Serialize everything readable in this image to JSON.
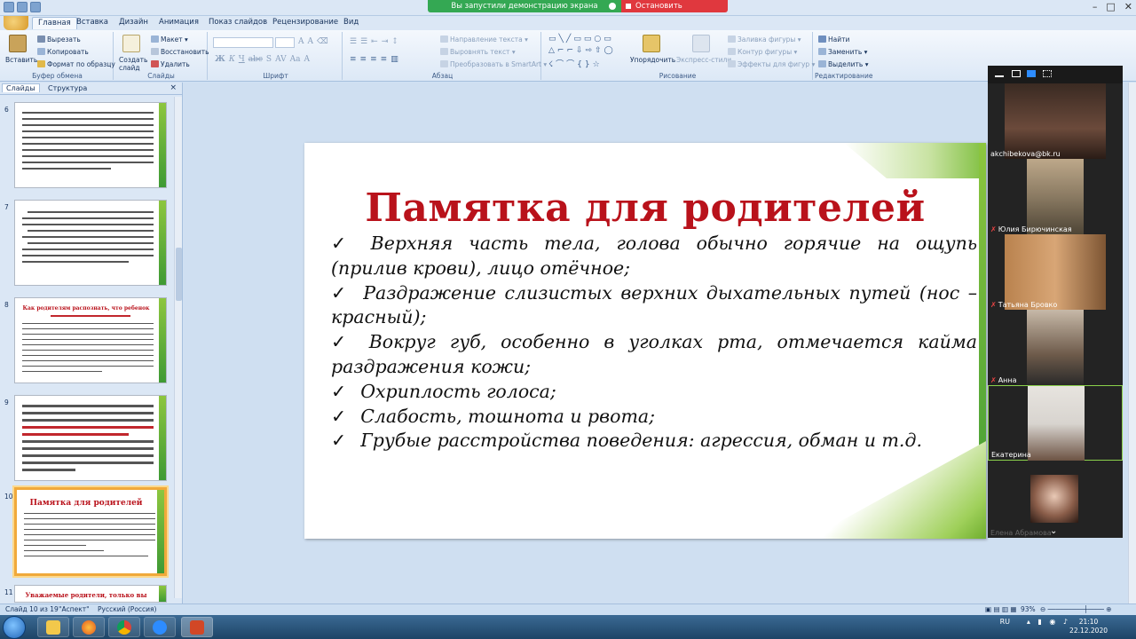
{
  "share_banner": {
    "message": "Вы запустили демонстрацию экрана",
    "stop_label": "Остановить демонстрацию"
  },
  "ribbon_tabs": [
    {
      "label": "Главная",
      "active": true
    },
    {
      "label": "Вставка"
    },
    {
      "label": "Дизайн"
    },
    {
      "label": "Анимация"
    },
    {
      "label": "Показ слайдов"
    },
    {
      "label": "Рецензирование"
    },
    {
      "label": "Вид"
    }
  ],
  "ribbon": {
    "clipboard": {
      "paste": "Вставить",
      "cut": "Вырезать",
      "copy": "Копировать",
      "format_painter": "Формат по образцу",
      "label": "Буфер обмена"
    },
    "slides": {
      "create": "Создать слайд",
      "layout": "Макет",
      "reset": "Восстановить",
      "delete": "Удалить",
      "label": "Слайды"
    },
    "font": {
      "label": "Шрифт"
    },
    "paragraph": {
      "direction": "Направление текста",
      "align": "Выровнять текст",
      "smartart": "Преобразовать в SmartArt",
      "label": "Абзац"
    },
    "drawing": {
      "arrange": "Упорядочить",
      "quick_styles": "Экспресс-стили",
      "fill": "Заливка фигуры",
      "outline": "Контур фигуры",
      "effects": "Эффекты для фигур",
      "label": "Рисование"
    },
    "editing": {
      "find": "Найти",
      "replace": "Заменить",
      "select": "Выделить",
      "label": "Редактирование"
    }
  },
  "left_pane": {
    "tabs": [
      "Слайды",
      "Структура"
    ],
    "thumbs": [
      {
        "num": "6"
      },
      {
        "num": "7"
      },
      {
        "num": "8",
        "title": "Как родителям распознать, что ребенок"
      },
      {
        "num": "9"
      },
      {
        "num": "10",
        "title": "Памятка для родителей",
        "selected": true
      },
      {
        "num": "11",
        "title": "Уважаемые родители, только вы можете"
      }
    ]
  },
  "slide": {
    "title": "Памятка для родителей",
    "items": [
      "Верхняя часть тела, голова обычно горячие на ощупь (прилив крови), лицо отёчное;",
      "Раздражение слизистых верхних дыхательных путей (нос – красный);",
      "Вокруг губ, особенно в уголках рта, отмечается кайма раздражения кожи;",
      "Охриплость голоса;",
      "Слабость, тошнота и рвота;",
      "Грубые расстройства поведения: агрессия, обман и т.д."
    ],
    "check": "✓"
  },
  "status": {
    "slide": "Слайд 10 из 19",
    "theme": "\"Аспект\"",
    "lang": "Русский (Россия)",
    "zoom": "93%"
  },
  "taskbar": {
    "lang": "RU",
    "time": "21:10",
    "date": "22.12.2020"
  },
  "participants": [
    {
      "name": "akchibekova@bk.ru",
      "muted": false,
      "color": "#6b4a3b"
    },
    {
      "name": "Юлия Бирючинская",
      "muted": true,
      "color": "#8a7a62"
    },
    {
      "name": "Татьяна Бровко",
      "muted": true,
      "color": "#a8784c"
    },
    {
      "name": "Анна",
      "muted": true,
      "color": "#6d5a4a"
    },
    {
      "name": "Екатерина",
      "muted": false,
      "active": true,
      "color": "#d8d4cf"
    },
    {
      "name": "Елена Абрамова",
      "muted": false,
      "color": "#8b5e4a"
    }
  ]
}
